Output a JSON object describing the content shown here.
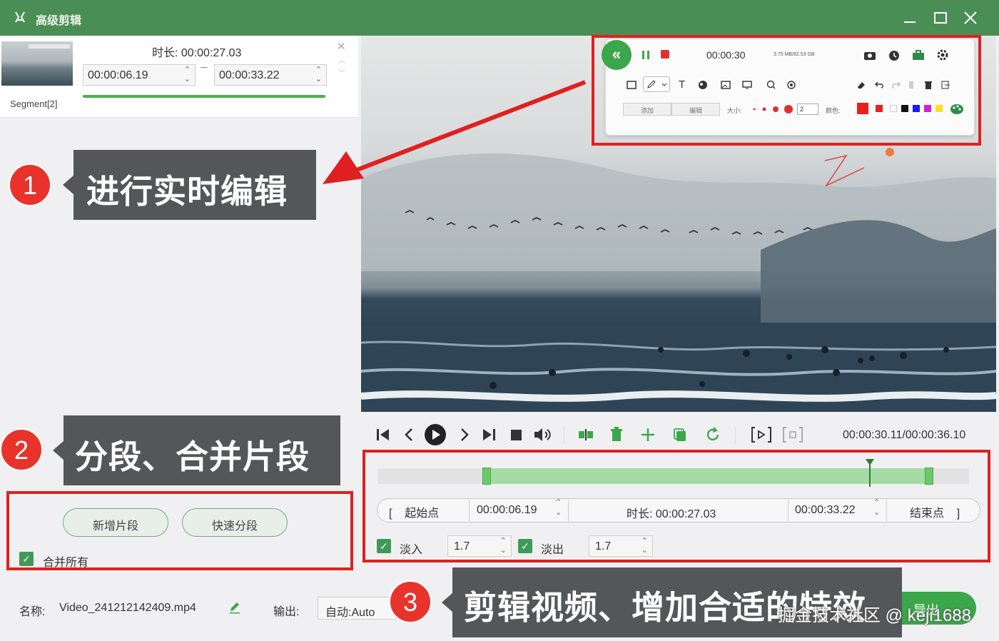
{
  "app": {
    "title": "高级剪辑"
  },
  "segment": {
    "name": "Segment[2]",
    "duration_label": "时长:",
    "duration_value": "00:00:27.03",
    "start": "00:00:06.19",
    "end": "00:00:33.22"
  },
  "left_actions": {
    "add_segment": "新增片段",
    "quick_split": "快速分段",
    "merge_all": "合并所有"
  },
  "callouts": [
    {
      "number": "1",
      "text": "进行实时编辑"
    },
    {
      "number": "2",
      "text": "分段、合并片段"
    },
    {
      "number": "3",
      "text": "剪辑视频、增加合适的特效"
    }
  ],
  "recorder_toolbar": {
    "time": "00:00:30",
    "size": "3.75 MB/82.53 GB",
    "tabs": [
      "添加",
      "编辑"
    ],
    "size_label": "大小:",
    "width_value": "2",
    "color_label": "颜色:",
    "colors": [
      "#e82020",
      "#e82020",
      "#ffffff",
      "#111111",
      "#1a1aff",
      "#d020d0",
      "#ffe020"
    ]
  },
  "transport": {
    "time": "00:00:30.11/00:00:36.10"
  },
  "trim": {
    "start_label": "起始点",
    "start_value": "00:00:06.19",
    "duration_label": "时长:",
    "duration_value": "00:00:27.03",
    "end_value": "00:00:33.22",
    "end_label": "结束点",
    "fade_in_label": "淡入",
    "fade_in_value": "1.7",
    "fade_out_label": "淡出",
    "fade_out_value": "1.7"
  },
  "bottom": {
    "name_label": "名称:",
    "file_name": "Video_241212142409.mp4",
    "output_label": "输出:",
    "output_value": "自动:Auto",
    "export_label": "导出"
  },
  "watermark": "掘金技术社区 @ keji1688",
  "accent_color": "#4b8e55"
}
